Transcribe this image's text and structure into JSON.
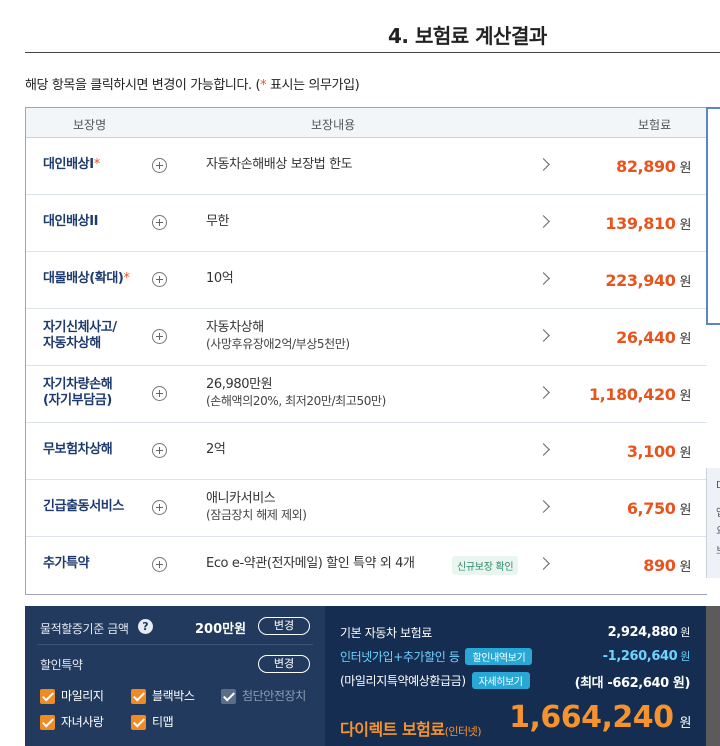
{
  "page": {
    "title": "4. 보험료 계산결과",
    "notice_prefix": "해당 항목을 클릭하시면 변경이 가능합니다. (",
    "notice_star": "*",
    "notice_suffix": " 표시는 의무가입)"
  },
  "table": {
    "headers": {
      "name": "보장명",
      "content": "보장내용",
      "premium": "보험료"
    },
    "rows": [
      {
        "name": "대인배상I",
        "star": "*",
        "desc": "자동차손해배상 보장법 한도",
        "sub": "",
        "price": "82,890",
        "unit": "원"
      },
      {
        "name": "대인배상II",
        "star": "",
        "desc": "무한",
        "sub": "",
        "price": "139,810",
        "unit": "원"
      },
      {
        "name": "대물배상(확대)",
        "star": "*",
        "desc": "10억",
        "sub": "",
        "price": "223,940",
        "unit": "원"
      },
      {
        "name": "자기신체사고/",
        "name2": "자동차상해",
        "star": "",
        "desc": "자동차상해",
        "sub": "(사망후유장애2억/부상5천만)",
        "price": "26,440",
        "unit": "원"
      },
      {
        "name": "자기차량손해",
        "name2": "(자기부담금)",
        "star": "",
        "desc": "26,980만원",
        "sub": "(손해액의20%, 최저20만/최고50만)",
        "price": "1,180,420",
        "unit": "원"
      },
      {
        "name": "무보험차상해",
        "star": "",
        "desc": "2억",
        "sub": "",
        "price": "3,100",
        "unit": "원"
      },
      {
        "name": "긴급출동서비스",
        "star": "",
        "desc": "애니카서비스",
        "sub": "(잠금장치 해제 제외)",
        "price": "6,750",
        "unit": "원"
      },
      {
        "name": "추가특약",
        "star": "",
        "desc": "Eco e-약관(전자메일) 할인 특약 외 4개",
        "sub": "",
        "badge": "신규보장 확인",
        "price": "890",
        "unit": "원"
      }
    ]
  },
  "side_peek": {
    "lines": [
      "D",
      "업",
      "요",
      "보"
    ]
  },
  "summary_left": {
    "accumulation_label": "물적할증기준 금액",
    "help_icon": "?",
    "accumulation_value": "200만원",
    "change_btn": "변경",
    "discount_label": "할인특약",
    "discount_change_btn": "변경",
    "options": [
      {
        "label": "마일리지",
        "checked": true,
        "disabled": false
      },
      {
        "label": "블랙박스",
        "checked": true,
        "disabled": false
      },
      {
        "label": "첨단안전장치",
        "checked": true,
        "disabled": true
      },
      {
        "label": "자녀사랑",
        "checked": true,
        "disabled": false
      },
      {
        "label": "티맵",
        "checked": true,
        "disabled": false
      }
    ]
  },
  "summary_right": {
    "base_label": "기본 자동차 보험료",
    "base_value": "2,924,880",
    "discount_label": "인터넷가입+추가할인 등",
    "discount_btn": "할인내역보기",
    "discount_value": "-1,260,640",
    "mileage_label": "(마일리지특약예상환급금)",
    "mileage_btn": "자세히보기",
    "mileage_value": "(최대 -662,640 원)",
    "unit": "원",
    "final_label": "다이렉트 보험료",
    "final_label_small": "(인터넷)",
    "final_value": "1,664,240",
    "final_unit": "원"
  },
  "colors": {
    "accent_orange": "#e8541e",
    "navy": "#152d50",
    "checkbox_orange": "#f08a24"
  }
}
